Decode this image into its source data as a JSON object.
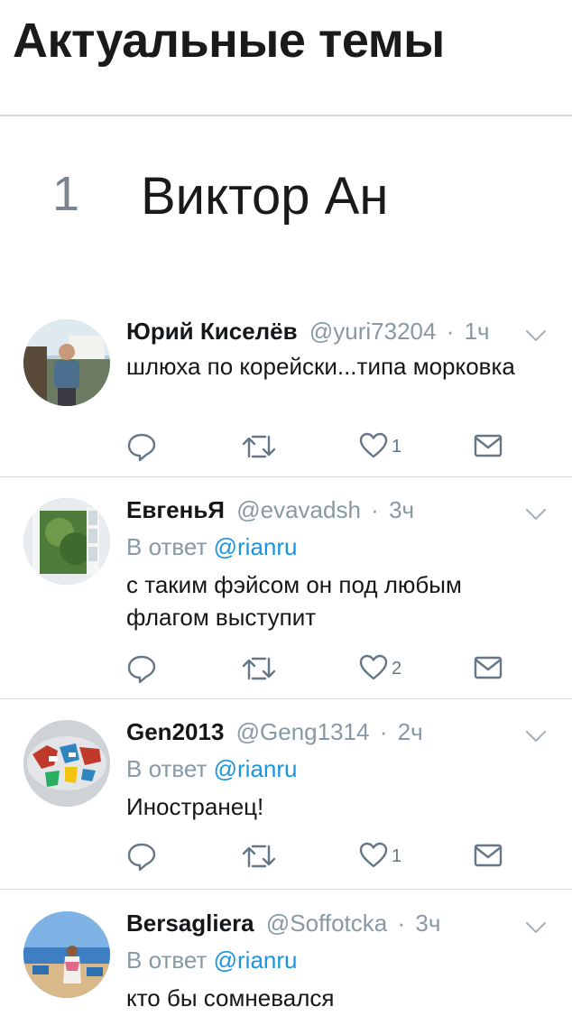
{
  "header": {
    "title": "Актуальные темы"
  },
  "trend": {
    "rank": "1",
    "name": "Виктор Ан"
  },
  "tweets": [
    {
      "name": "Юрий Киселёв",
      "handle": "@yuri73204",
      "dot": "·",
      "time": "1ч",
      "reply_prefix": "",
      "reply_mention": "",
      "text": "шлюха по корейски...типа морковка",
      "likes": "1"
    },
    {
      "name": "ЕвгеньЯ",
      "handle": "@evavadsh",
      "dot": "·",
      "time": "3ч",
      "reply_prefix": "В ответ",
      "reply_mention": "@rianru",
      "text": "с таким фэйсом он под любым флагом выступит",
      "likes": "2"
    },
    {
      "name": "Gen2013",
      "handle": "@Geng1314",
      "dot": "·",
      "time": "2ч",
      "reply_prefix": "В ответ",
      "reply_mention": "@rianru",
      "text": "Иностранец!",
      "likes": "1"
    },
    {
      "name": "Bersagliera",
      "handle": "@Soffotcka",
      "dot": "·",
      "time": "3ч",
      "reply_prefix": "В ответ",
      "reply_mention": "@rianru",
      "text": "кто бы сомневался",
      "likes": ""
    }
  ],
  "icons": {
    "reply": "reply-icon",
    "retweet": "retweet-icon",
    "like": "heart-icon",
    "dm": "envelope-icon",
    "menu": "chevron-down-icon"
  },
  "colors": {
    "text": "#14171a",
    "muted": "#8899a6",
    "link": "#1b95e0",
    "action": "#657786",
    "divider": "#d9dde0"
  }
}
